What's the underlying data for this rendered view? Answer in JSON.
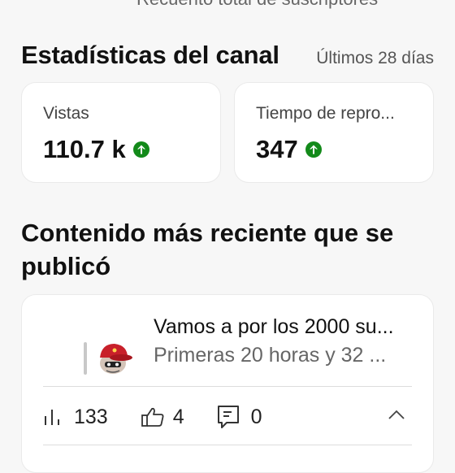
{
  "top_label": "Recuento total de suscriptores",
  "channel_stats": {
    "title": "Estadísticas del canal",
    "period": "Últimos 28 días",
    "cards": [
      {
        "label": "Vistas",
        "value": "110.7 k",
        "trend": "up"
      },
      {
        "label": "Tiempo de repro...",
        "value": "347",
        "trend": "up"
      }
    ]
  },
  "recent": {
    "title": "Contenido más reciente que se publicó",
    "video": {
      "title": "Vamos a por los 2000 su...",
      "subtitle": "Primeras 20 horas y 32 ...",
      "views": "133",
      "likes": "4",
      "comments": "0"
    }
  },
  "colors": {
    "trend_up": "#138a1a",
    "card_bg": "#ffffff",
    "page_bg": "#f7f7f7"
  }
}
